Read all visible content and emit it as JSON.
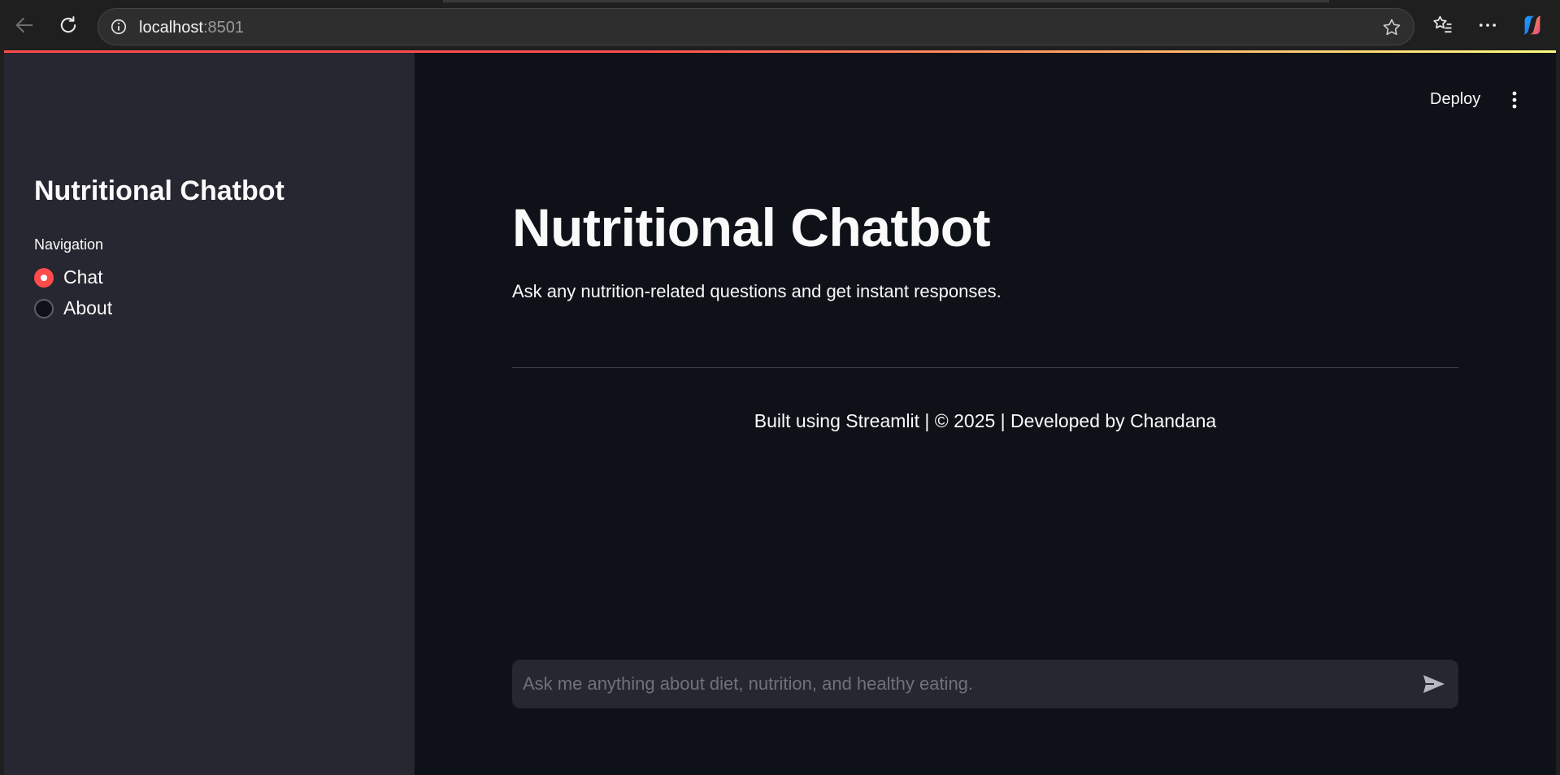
{
  "browser": {
    "url_host": "localhost",
    "url_port": ":8501"
  },
  "header": {
    "deploy_label": "Deploy"
  },
  "sidebar": {
    "title": "Nutritional Chatbot",
    "nav_label": "Navigation",
    "options": [
      {
        "label": "Chat",
        "selected": true
      },
      {
        "label": "About",
        "selected": false
      }
    ]
  },
  "main": {
    "title": "Nutritional Chatbot",
    "subtitle": "Ask any nutrition-related questions and get instant responses.",
    "footer": "Built using Streamlit | © 2025 | Developed by Chandana",
    "chat_placeholder": "Ask me anything about diet, nutrition, and healthy eating."
  },
  "colors": {
    "accent": "#ff4b4b",
    "background": "#0e1117",
    "sidebar": "#262730"
  }
}
